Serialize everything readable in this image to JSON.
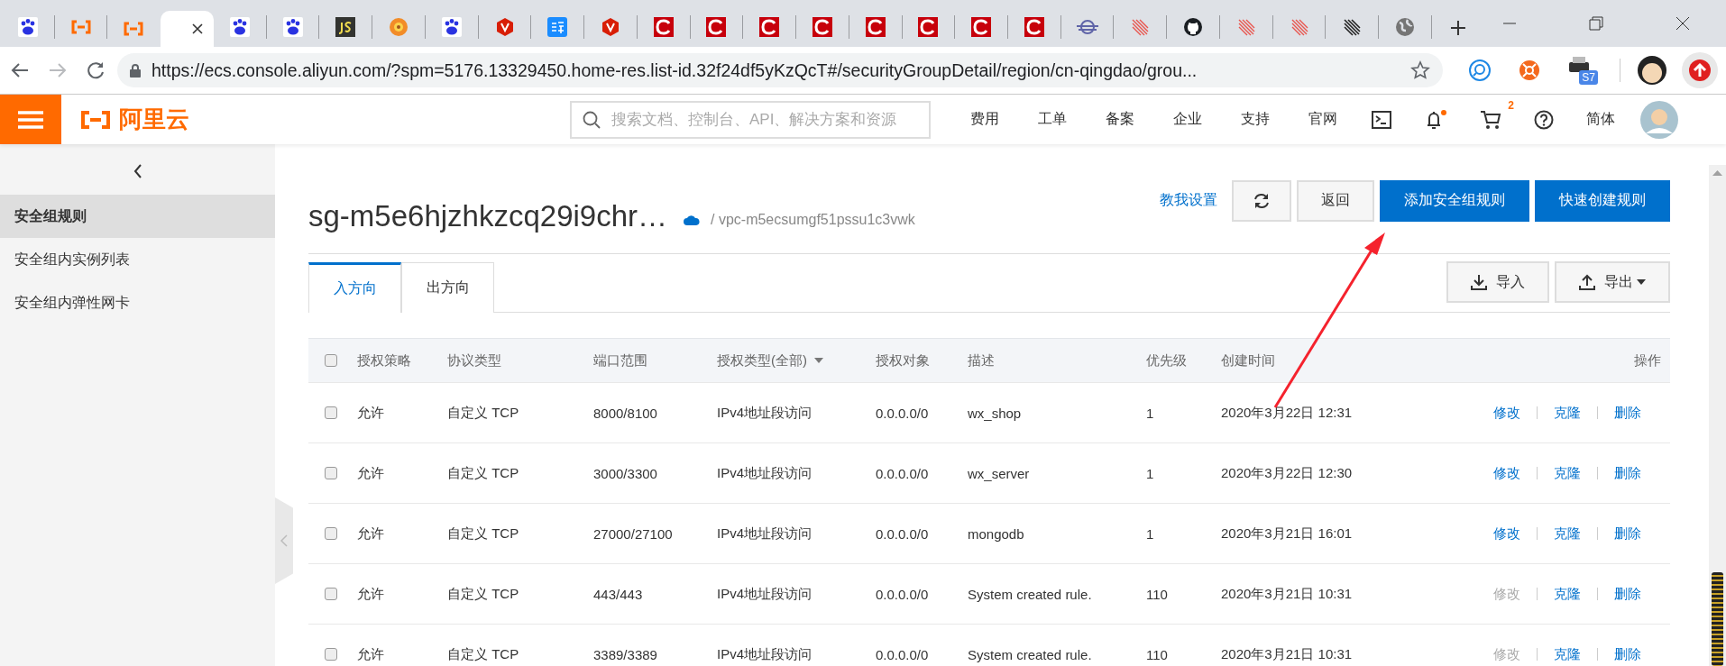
{
  "browser": {
    "tabs": [
      {
        "kind": "paw",
        "selected": false
      },
      {
        "kind": "bracket",
        "selected": false
      },
      {
        "kind": "bracket",
        "selected": false
      },
      {
        "kind": "blank",
        "selected": true
      },
      {
        "kind": "paw",
        "selected": false
      },
      {
        "kind": "paw",
        "selected": false
      },
      {
        "kind": "js",
        "selected": false
      },
      {
        "kind": "flower",
        "selected": false
      },
      {
        "kind": "paw",
        "selected": false
      },
      {
        "kind": "hexagon",
        "selected": false
      },
      {
        "kind": "square",
        "selected": false
      },
      {
        "kind": "hexagon",
        "selected": false
      },
      {
        "kind": "c",
        "selected": false
      },
      {
        "kind": "c",
        "selected": false
      },
      {
        "kind": "c",
        "selected": false
      },
      {
        "kind": "c",
        "selected": false
      },
      {
        "kind": "c",
        "selected": false
      },
      {
        "kind": "c",
        "selected": false
      },
      {
        "kind": "c",
        "selected": false
      },
      {
        "kind": "c",
        "selected": false
      },
      {
        "kind": "ring",
        "selected": false
      },
      {
        "kind": "streak",
        "selected": false
      },
      {
        "kind": "github",
        "selected": false
      },
      {
        "kind": "streak",
        "selected": false
      },
      {
        "kind": "streak",
        "selected": false
      },
      {
        "kind": "darkstreak",
        "selected": false
      },
      {
        "kind": "globe",
        "selected": false
      }
    ],
    "address": "https://ecs.console.aliyun.com/?spm=5176.13329450.home-res.list-id.32f24df5yKzQcT#/securityGroupDetail/region/cn-qingdao/grou...",
    "extension_badge": "S7"
  },
  "header": {
    "logo_text": "阿里云",
    "search": {
      "placeholder": "搜索文档、控制台、API、解决方案和资源"
    },
    "nav": [
      "费用",
      "工单",
      "备案",
      "企业",
      "支持",
      "官网"
    ],
    "cart_count": "2",
    "language": "简体"
  },
  "sidebar": {
    "items": [
      {
        "label": "安全组规则",
        "selected": true
      },
      {
        "label": "安全组内实例列表",
        "selected": false
      },
      {
        "label": "安全组内弹性网卡",
        "selected": false
      }
    ]
  },
  "page": {
    "title": "sg-m5e6hjzhkzcq29i9chr…",
    "vpc": "/ vpc-m5ecsumgf51pssu1c3vwk",
    "help_link": "教我设置",
    "buttons": [
      {
        "label": "返回",
        "kind": "default"
      },
      {
        "label": "添加安全组规则",
        "kind": "primary"
      },
      {
        "label": "快速创建规则",
        "kind": "primary"
      }
    ]
  },
  "direction_tabs": [
    {
      "label": "入方向",
      "selected": true
    },
    {
      "label": "出方向",
      "selected": false
    }
  ],
  "actions": [
    {
      "label": "导入",
      "kind": "import"
    },
    {
      "label": "导出",
      "kind": "export"
    }
  ],
  "table": {
    "select_all_checked": false,
    "columns": [
      "授权策略",
      "协议类型",
      "端口范围",
      "授权类型(全部)",
      "授权对象",
      "描述",
      "优先级",
      "创建时间",
      "操作"
    ],
    "rows": [
      {
        "checked": false,
        "cells": [
          "允许",
          "自定义 TCP",
          "8000/8100",
          "IPv4地址段访问",
          "0.0.0.0/0",
          "wx_shop",
          "1",
          "2020年3月22日 12:31"
        ],
        "actions": [
          {
            "label": "修改",
            "disabled": false
          },
          {
            "label": "克隆",
            "disabled": false
          },
          {
            "label": "删除",
            "disabled": false
          }
        ]
      },
      {
        "checked": false,
        "cells": [
          "允许",
          "自定义 TCP",
          "3000/3300",
          "IPv4地址段访问",
          "0.0.0.0/0",
          "wx_server",
          "1",
          "2020年3月22日 12:30"
        ],
        "actions": [
          {
            "label": "修改",
            "disabled": false
          },
          {
            "label": "克隆",
            "disabled": false
          },
          {
            "label": "删除",
            "disabled": false
          }
        ]
      },
      {
        "checked": false,
        "cells": [
          "允许",
          "自定义 TCP",
          "27000/27100",
          "IPv4地址段访问",
          "0.0.0.0/0",
          "mongodb",
          "1",
          "2020年3月21日 16:01"
        ],
        "actions": [
          {
            "label": "修改",
            "disabled": false
          },
          {
            "label": "克隆",
            "disabled": false
          },
          {
            "label": "删除",
            "disabled": false
          }
        ]
      },
      {
        "checked": false,
        "cells": [
          "允许",
          "自定义 TCP",
          "443/443",
          "IPv4地址段访问",
          "0.0.0.0/0",
          "System created rule.",
          "110",
          "2020年3月21日 10:31"
        ],
        "actions": [
          {
            "label": "修改",
            "disabled": true
          },
          {
            "label": "克隆",
            "disabled": false
          },
          {
            "label": "删除",
            "disabled": false
          }
        ]
      },
      {
        "checked": false,
        "cells": [
          "允许",
          "自定义 TCP",
          "3389/3389",
          "IPv4地址段访问",
          "0.0.0.0/0",
          "System created rule.",
          "110",
          "2020年3月21日 10:31"
        ],
        "actions": [
          {
            "label": "修改",
            "disabled": true
          },
          {
            "label": "克隆",
            "disabled": false
          },
          {
            "label": "删除",
            "disabled": false
          }
        ]
      }
    ]
  }
}
